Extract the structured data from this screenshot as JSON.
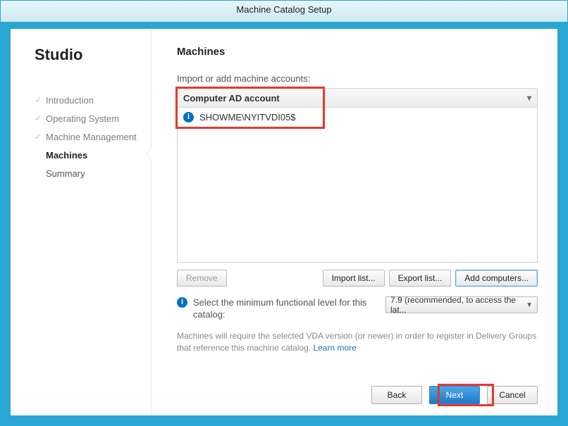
{
  "window": {
    "title": "Machine Catalog Setup"
  },
  "sidebar": {
    "brand": "Studio",
    "items": [
      {
        "label": "Introduction",
        "state": "done"
      },
      {
        "label": "Operating System",
        "state": "done"
      },
      {
        "label": "Machine Management",
        "state": "done"
      },
      {
        "label": "Machines",
        "state": "active"
      },
      {
        "label": "Summary",
        "state": "plain"
      }
    ]
  },
  "main": {
    "heading": "Machines",
    "instruction": "Import or add machine accounts:",
    "grid": {
      "header": "Computer AD account",
      "rows": [
        "SHOWME\\NYITVDI05$"
      ]
    },
    "buttons": {
      "remove": "Remove",
      "import": "Import list...",
      "export": "Export list...",
      "add": "Add computers..."
    },
    "functional": {
      "label": "Select the minimum functional level for this catalog:",
      "selected": "7.9 (recommended, to access the lat..."
    },
    "note_pre": "Machines will require the selected VDA version (or newer) in order to register in Delivery Groups that reference this machine catalog. ",
    "note_link": "Learn more"
  },
  "footer": {
    "back": "Back",
    "next": "Next",
    "cancel": "Cancel"
  }
}
